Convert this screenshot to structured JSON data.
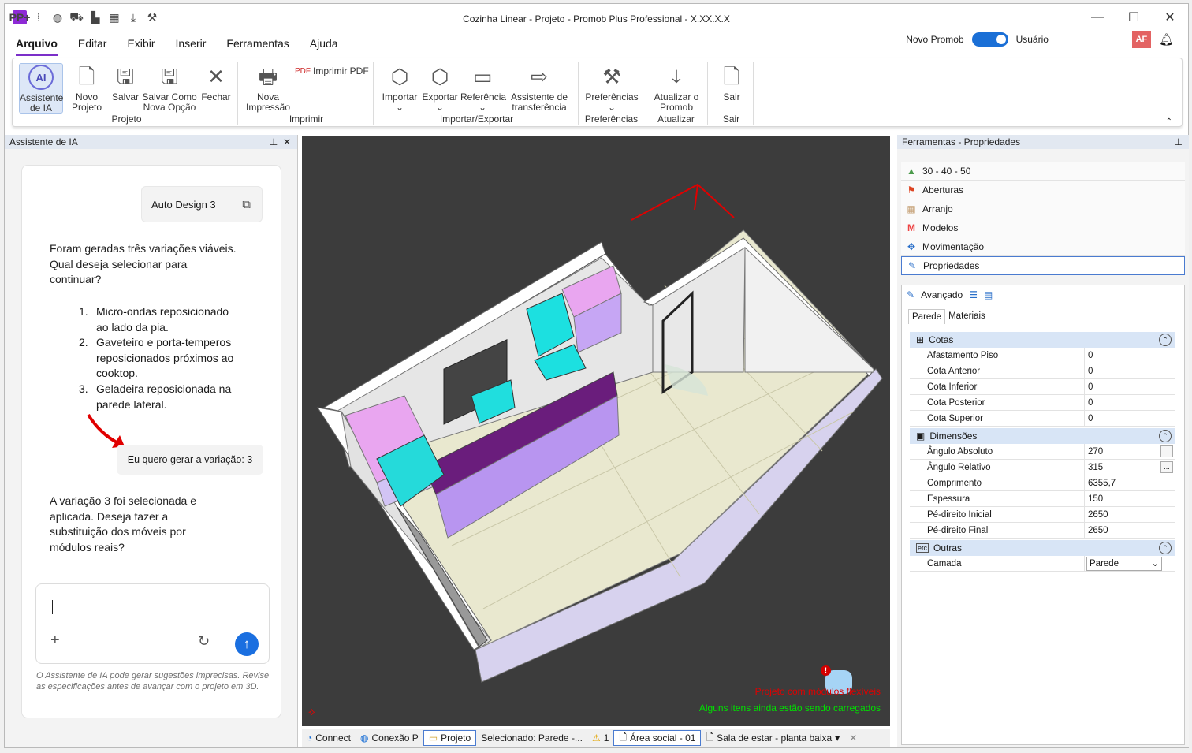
{
  "titlebar": {
    "title": "Cozinha Linear - Projeto - Promob Plus Professional - X.XX.X.X",
    "logo": "PP+"
  },
  "menu": [
    "Arquivo",
    "Editar",
    "Exibir",
    "Inserir",
    "Ferramentas",
    "Ajuda"
  ],
  "topright": {
    "novo_promob": "Novo Promob",
    "usuario": "Usuário",
    "avatar": "AF"
  },
  "ribbon": {
    "groups": {
      "projeto": "Projeto",
      "imprimir": "Imprimir",
      "importar_exportar": "Importar/Exportar",
      "preferencias": "Preferências",
      "atualizar": "Atualizar",
      "sair": "Sair"
    },
    "buttons": {
      "assistente": "Assistente de IA",
      "novo": "Novo Projeto",
      "salvar": "Salvar",
      "salvar_como": "Salvar Como Nova Opção",
      "fechar": "Fechar",
      "nova_impressao": "Nova Impressão",
      "imprimir_pdf": "Imprimir PDF",
      "importar": "Importar",
      "exportar": "Exportar",
      "referencia": "Referência",
      "assistente_transferencia": "Assistente de transferência",
      "preferencias": "Preferências",
      "atualizar": "Atualizar o Promob",
      "sair": "Sair"
    }
  },
  "ai_panel": {
    "header": "Assistente de IA",
    "chip": "Auto Design 3",
    "message1": "Foram geradas três variações viáveis. Qual deseja selecionar para continuar?",
    "options": [
      "Micro-ondas reposicionado ao lado da pia.",
      "Gaveteiro e porta-temperos reposicionados próximos ao cooktop.",
      "Geladeira reposicionada na parede lateral."
    ],
    "user_message": "Eu quero gerar a variação: 3",
    "message2": "A variação 3 foi selecionada e aplicada. Deseja fazer a substituição dos móveis por módulos reais?",
    "disclaimer": "O Assistente de IA pode gerar sugestões imprecisas. Revise as especificações antes de avançar com o projeto em 3D."
  },
  "viewport": {
    "warning_red": "Projeto com módulos flexíveis",
    "warning_green": "Alguns itens ainda estão sendo carregados"
  },
  "statusbar": {
    "connect": "Connect",
    "conexao": "Conexão P",
    "projeto": "Projeto",
    "selecionado": "Selecionado: Parede -...",
    "warnings": "1",
    "area": "Área social - 01",
    "sala": "Sala de estar - planta baixa"
  },
  "right_panel": {
    "header": "Ferramentas - Propriedades",
    "tools": [
      "30 - 40 - 50",
      "Aberturas",
      "Arranjo",
      "Modelos",
      "Movimentação",
      "Propriedades"
    ],
    "avancado": "Avançado",
    "tabs": [
      "Parede",
      "Materiais"
    ],
    "sections": [
      {
        "name": "Cotas",
        "rows": [
          {
            "k": "Afastamento Piso",
            "v": "0"
          },
          {
            "k": "Cota Anterior",
            "v": "0"
          },
          {
            "k": "Cota Inferior",
            "v": "0"
          },
          {
            "k": "Cota Posterior",
            "v": "0"
          },
          {
            "k": "Cota Superior",
            "v": "0"
          }
        ]
      },
      {
        "name": "Dimensões",
        "rows": [
          {
            "k": "Ângulo Absoluto",
            "v": "270"
          },
          {
            "k": "Ângulo Relativo",
            "v": "315"
          },
          {
            "k": "Comprimento",
            "v": "6355,7"
          },
          {
            "k": "Espessura",
            "v": "150"
          },
          {
            "k": "Pé-direito Inicial",
            "v": "2650"
          },
          {
            "k": "Pé-direito Final",
            "v": "2650"
          }
        ]
      },
      {
        "name": "Outras",
        "rows": [
          {
            "k": "Camada",
            "v": "Parede"
          }
        ]
      }
    ]
  }
}
